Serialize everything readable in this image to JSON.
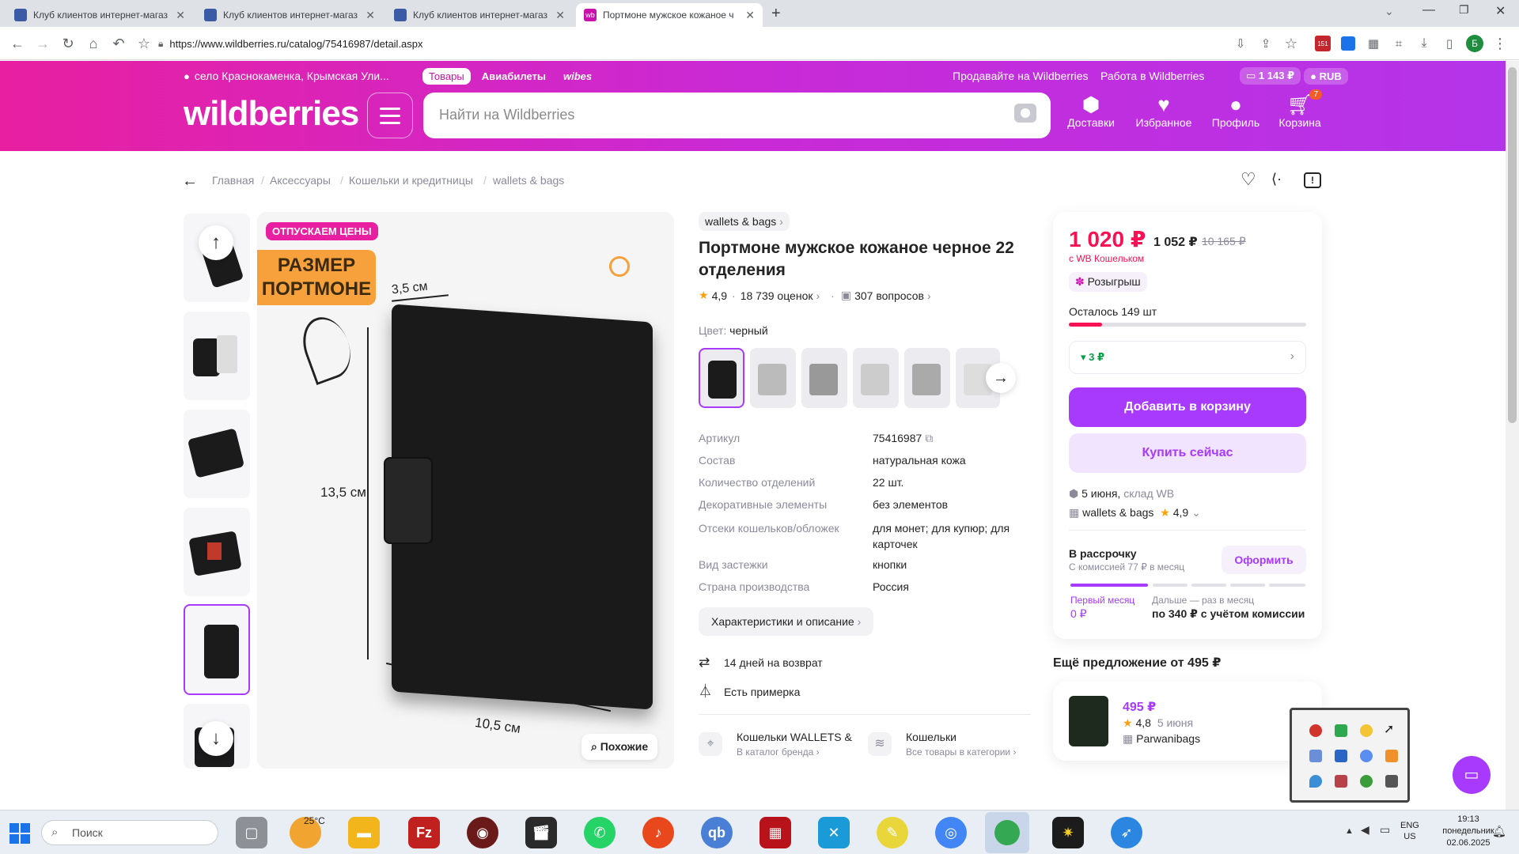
{
  "browser": {
    "tabs": [
      {
        "label": "Клуб клиентов интернет-магаз",
        "active": false
      },
      {
        "label": "Клуб клиентов интернет-магаз",
        "active": false
      },
      {
        "label": "Клуб клиентов интернет-магаз",
        "active": false
      },
      {
        "label": "Портмоне мужское кожаное ч",
        "active": true
      }
    ],
    "new_tab": "+",
    "url": "https://www.wildberries.ru/catalog/75416987/detail.aspx",
    "ext_badge": "151"
  },
  "header": {
    "location": "село Краснокаменка, Крымская Ули...",
    "tabs": [
      "Товары",
      "Авиабилеты",
      "wibes"
    ],
    "sell_link": "Продавайте на Wildberries",
    "work_link": "Работа в Wildberries",
    "balance": "1 143 ₽",
    "currency": "RUB",
    "logo": "wildberries",
    "search_placeholder": "Найти на Wildberries",
    "nav": [
      {
        "label": "Доставки",
        "icon": "box-icon"
      },
      {
        "label": "Избранное",
        "icon": "heart-icon"
      },
      {
        "label": "Профиль",
        "icon": "user-icon"
      },
      {
        "label": "Корзина",
        "icon": "cart-icon"
      }
    ],
    "cart_count": "7"
  },
  "breadcrumbs": [
    "Главная",
    "Аксессуары",
    "Кошельки и кредитницы",
    "wallets & bags"
  ],
  "gallery": {
    "promo": "ОТПУСКАЕМ ЦЕНЫ",
    "size_title": "РАЗМЕР ПОРТМОНЕ",
    "dim_top": "3,5 см",
    "dim_side": "13,5 см",
    "dim_bottom": "10,5 см",
    "similar_btn": "Похожие"
  },
  "product": {
    "brand": "wallets & bags",
    "title": "Портмоне мужское кожаное черное 22 отделения",
    "rating": "4,9",
    "reviews": "18 739 оценок",
    "questions": "307 вопросов",
    "color_label": "Цвет:",
    "color_value": "черный",
    "specs": [
      {
        "k": "Артикул",
        "v": "75416987"
      },
      {
        "k": "Состав",
        "v": "натуральная кожа"
      },
      {
        "k": "Количество отделений",
        "v": "22 шт."
      },
      {
        "k": "Декоративные элементы",
        "v": "без элементов"
      },
      {
        "k": "Отсеки кошельков/обложек",
        "v": "для монет; для купюр; для карточек"
      },
      {
        "k": "Вид застежки",
        "v": "кнопки"
      },
      {
        "k": "Страна производства",
        "v": "Россия"
      }
    ],
    "specs_button": "Характеристики и описание",
    "return_text": "14 дней на возврат",
    "fitting_text": "Есть примерка",
    "brand_link_title": "Кошельки WALLETS & BAGS",
    "brand_link_sub": "В каталог бренда",
    "category_link_title": "Кошельки",
    "category_link_sub": "Все товары в категории"
  },
  "buy_card": {
    "price": "1 020 ₽",
    "price_no_wallet": "1 052 ₽",
    "price_old": "10 165 ₽",
    "wallet_note": "с WB Кошельком",
    "raffle": "Розыгрыш",
    "stock": "Осталось 149 шт",
    "stock_fraction": 0.14,
    "price_drop": "▾ 3 ₽",
    "add_to_cart": "Добавить в корзину",
    "buy_now": "Купить сейчас",
    "delivery_date": "5 июня,",
    "delivery_wh": "склад WB",
    "seller": "wallets & bags",
    "seller_rating": "4,9",
    "installment_title": "В рассрочку",
    "installment_sub": "С комиссией 77 ₽ в месяц",
    "installment_btn": "Оформить",
    "first_month_label": "Первый месяц",
    "first_month_value": "0 ₽",
    "later_label": "Дальше — раз в месяц",
    "later_value": "по 340 ₽ с учётом комиссии"
  },
  "other_offer": {
    "title": "Ещё предложение от 495 ₽",
    "price": "495 ₽",
    "rating": "4,8",
    "date": "5 июня",
    "seller": "Parwanibags"
  },
  "taskbar": {
    "search_placeholder": "Поиск",
    "weather": "25°C",
    "lang_top": "ENG",
    "lang_bottom": "US",
    "time": "19:13",
    "day": "понедельник",
    "date": "02.06.2025"
  },
  "colors": {
    "brand_pink": "#e81fa0",
    "brand_purple": "#a73afd",
    "price_red": "#f91155"
  }
}
